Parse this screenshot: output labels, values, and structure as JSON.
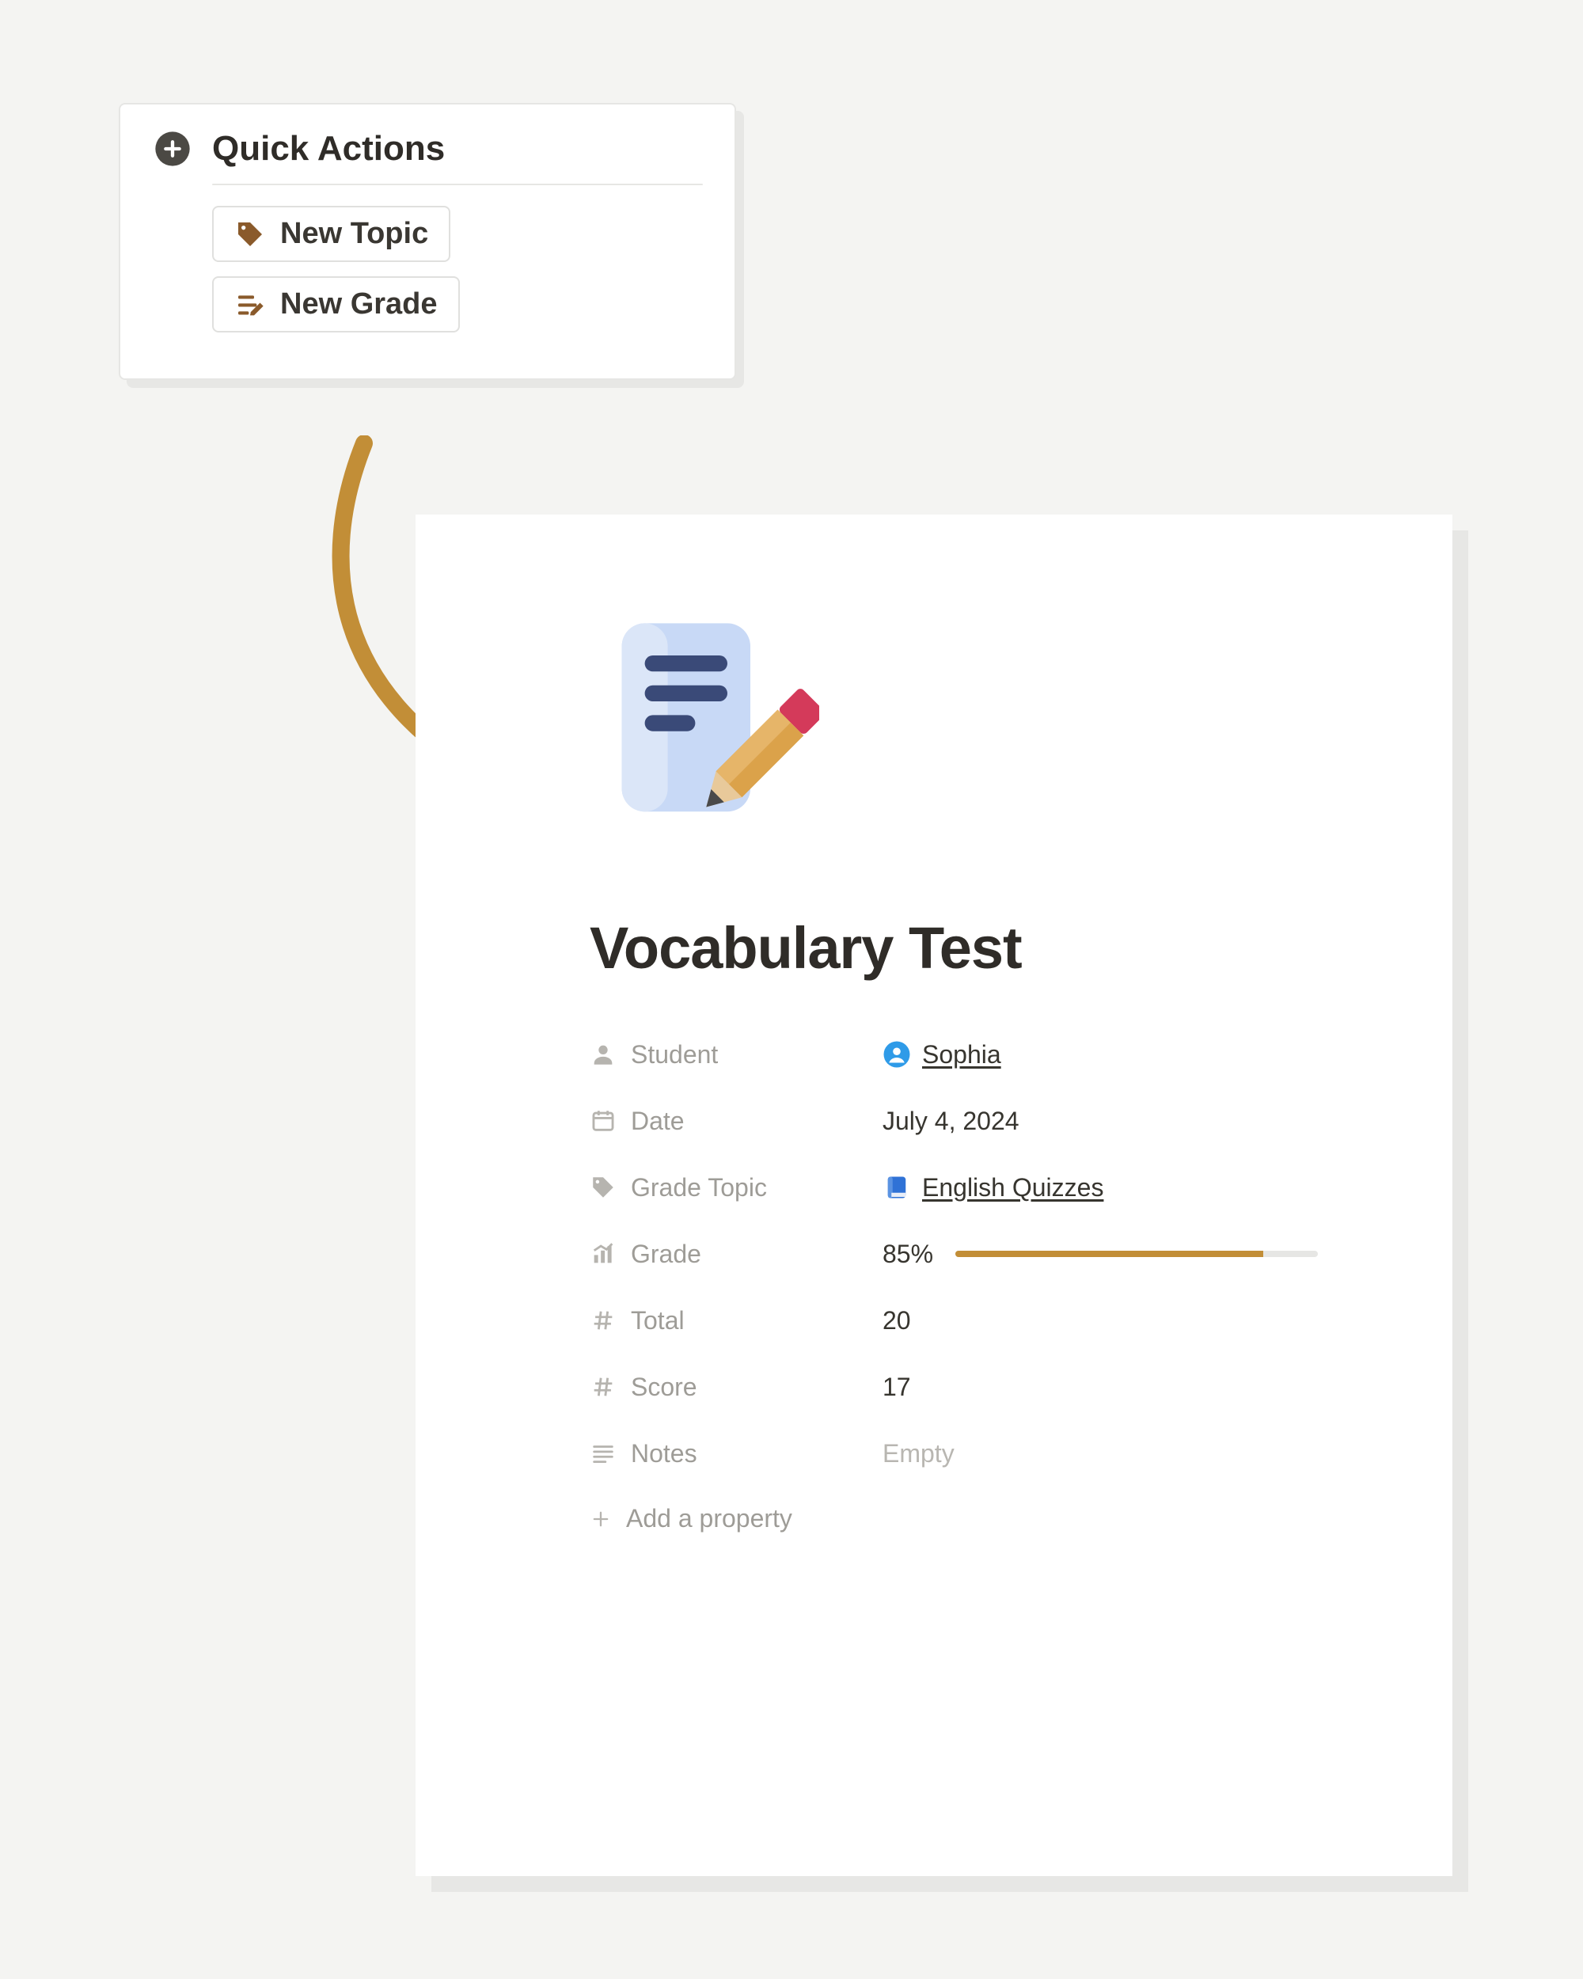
{
  "quick_actions": {
    "title": "Quick Actions",
    "buttons": {
      "new_topic": "New Topic",
      "new_grade": "New Grade"
    }
  },
  "detail": {
    "title": "Vocabulary Test",
    "properties": {
      "student": {
        "label": "Student",
        "value": "Sophia"
      },
      "date": {
        "label": "Date",
        "value": "July 4, 2024"
      },
      "topic": {
        "label": "Grade Topic",
        "value": "English Quizzes"
      },
      "grade": {
        "label": "Grade",
        "value_text": "85%",
        "percent": 85
      },
      "total": {
        "label": "Total",
        "value": "20"
      },
      "score": {
        "label": "Score",
        "value": "17"
      },
      "notes": {
        "label": "Notes",
        "value": "Empty"
      }
    },
    "add_property": "Add a property"
  },
  "colors": {
    "accent": "#c28e37"
  }
}
